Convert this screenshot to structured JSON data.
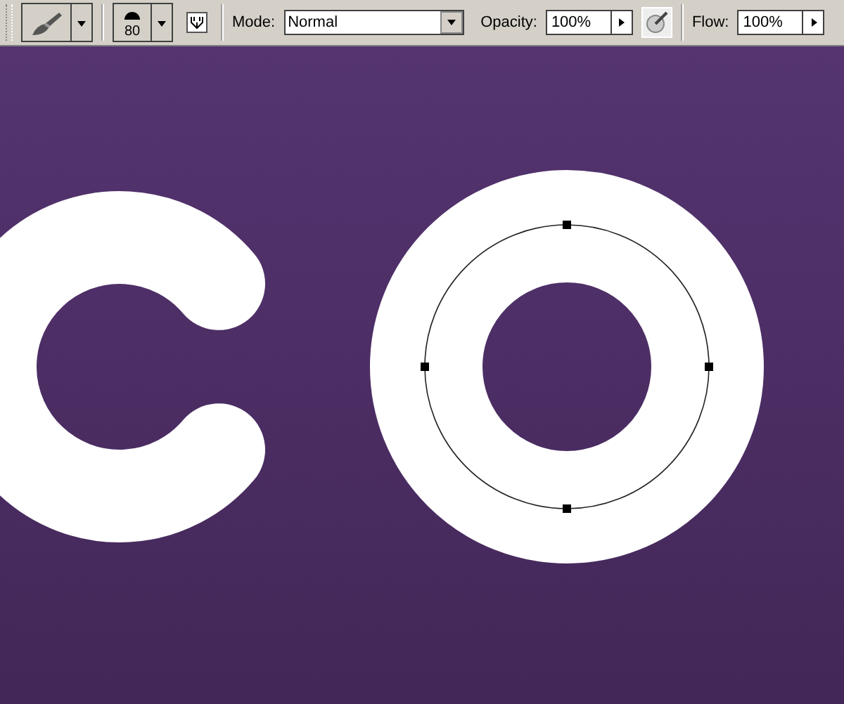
{
  "options_bar": {
    "brush_size": "80",
    "mode": {
      "label": "Mode:",
      "value": "Normal"
    },
    "opacity": {
      "label": "Opacity:",
      "value": "100%"
    },
    "flow": {
      "label": "Flow:",
      "value": "100%"
    }
  }
}
